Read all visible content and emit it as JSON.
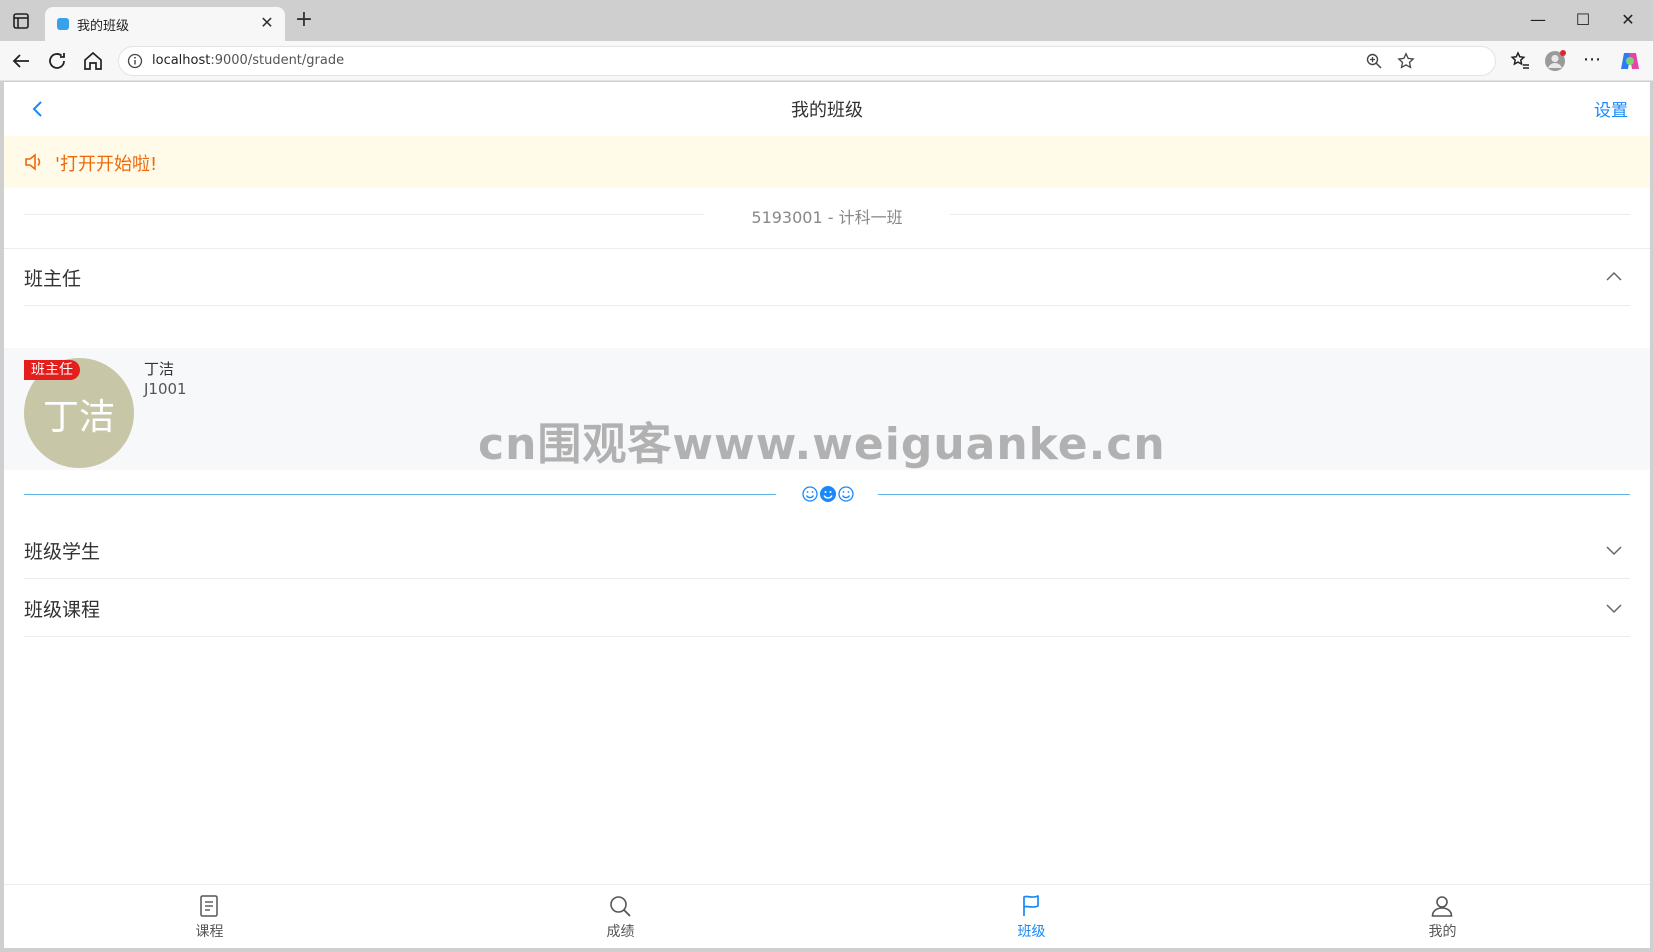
{
  "browser": {
    "tab_title": "我的班级",
    "url_host": "localhost",
    "url_rest": ":9000/student/grade"
  },
  "header": {
    "title": "我的班级",
    "settings_label": "设置"
  },
  "notice": {
    "text": "'打开开始啦!"
  },
  "class_info": {
    "text": "5193001 - 计科一班"
  },
  "sections": {
    "head_teacher": "班主任",
    "students": "班级学生",
    "courses": "班级课程"
  },
  "teacher": {
    "badge": "班主任",
    "avatar_text": "丁洁",
    "name": "丁洁",
    "id": "J1001"
  },
  "watermark": "cn围观客www.weiguanke.cn",
  "tabbar": {
    "items": [
      {
        "label": "课程",
        "icon": "document-icon",
        "active": false
      },
      {
        "label": "成绩",
        "icon": "search-icon",
        "active": false
      },
      {
        "label": "班级",
        "icon": "flag-icon",
        "active": true
      },
      {
        "label": "我的",
        "icon": "user-icon",
        "active": false
      }
    ]
  },
  "colors": {
    "accent": "#1989fa",
    "notice_text": "#ed6a0c",
    "notice_bg": "#fffbe8",
    "badge": "#e41d1d",
    "avatar": "#c7c6a7"
  }
}
